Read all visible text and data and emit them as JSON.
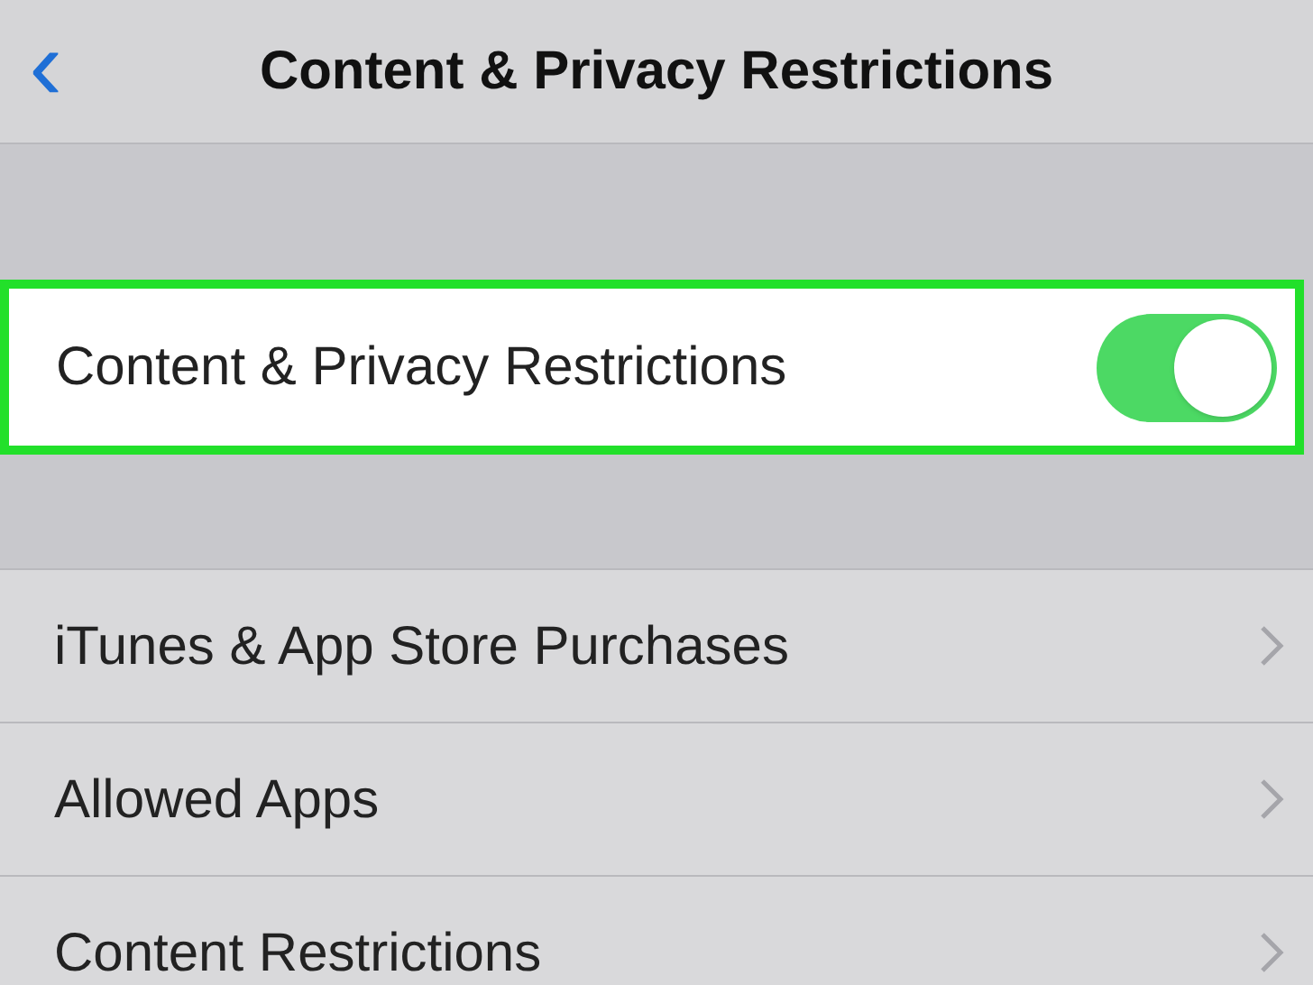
{
  "nav_bar": {
    "back": "‹",
    "title": "Content & Privacy Restrictions"
  },
  "main_toggle": {
    "label": "Content & Privacy Restrictions",
    "on": true,
    "highlighted": true
  },
  "items": [
    {
      "label": "iTunes & App Store Purchases"
    },
    {
      "label": "Allowed Apps"
    },
    {
      "label": "Content Restrictions"
    }
  ]
}
